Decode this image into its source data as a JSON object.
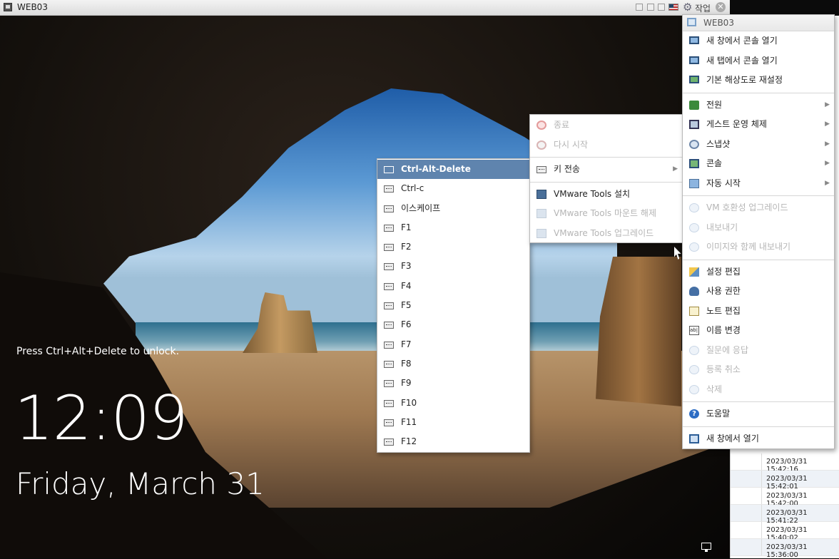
{
  "window": {
    "title": "WEB03",
    "action_label": "작업"
  },
  "lockscreen": {
    "unlock_hint": "Press Ctrl+Alt+Delete to unlock.",
    "time": "12:09",
    "date": "Friday, March 31"
  },
  "actions_menu": {
    "header": "WEB03",
    "items": [
      {
        "label": "새 창에서 콘솔 열기",
        "icon": "monitor-icon",
        "enabled": true
      },
      {
        "label": "새 탭에서 콘솔 열기",
        "icon": "monitor-icon",
        "enabled": true
      },
      {
        "label": "기본 해상도로 재설정",
        "icon": "monitor-reset-icon",
        "enabled": true
      },
      {
        "label": "전원",
        "icon": "power-icon",
        "enabled": true,
        "submenu": true
      },
      {
        "label": "게스트 운영 체제",
        "icon": "guest-os-icon",
        "enabled": true,
        "submenu": true
      },
      {
        "label": "스냅샷",
        "icon": "snapshot-icon",
        "enabled": true,
        "submenu": true
      },
      {
        "label": "콘솔",
        "icon": "console-icon",
        "enabled": true,
        "submenu": true
      },
      {
        "label": "자동 시작",
        "icon": "autostart-icon",
        "enabled": true,
        "submenu": true
      },
      {
        "label": "VM 호환성 업그레이드",
        "icon": "upgrade-icon",
        "enabled": false
      },
      {
        "label": "내보내기",
        "icon": "export-icon",
        "enabled": false
      },
      {
        "label": "이미지와 함께 내보내기",
        "icon": "export-image-icon",
        "enabled": false
      },
      {
        "label": "설정 편집",
        "icon": "edit-settings-icon",
        "enabled": true
      },
      {
        "label": "사용 권한",
        "icon": "permissions-icon",
        "enabled": true
      },
      {
        "label": "노트 편집",
        "icon": "edit-notes-icon",
        "enabled": true
      },
      {
        "label": "이름 변경",
        "icon": "rename-icon",
        "enabled": true
      },
      {
        "label": "질문에 응답",
        "icon": "answer-question-icon",
        "enabled": false
      },
      {
        "label": "등록 취소",
        "icon": "unregister-icon",
        "enabled": false
      },
      {
        "label": "삭제",
        "icon": "delete-icon",
        "enabled": false
      },
      {
        "label": "도움말",
        "icon": "help-icon",
        "enabled": true
      },
      {
        "label": "새 창에서 열기",
        "icon": "new-window-icon",
        "enabled": true
      }
    ]
  },
  "guest_os_menu": {
    "items": [
      {
        "label": "종료",
        "icon": "shutdown-icon",
        "enabled": false
      },
      {
        "label": "다시 시작",
        "icon": "restart-icon",
        "enabled": false
      },
      {
        "label": "키 전송",
        "icon": "keyboard-icon",
        "enabled": true,
        "submenu": true
      },
      {
        "label": "VMware Tools 설치",
        "icon": "vmware-tools-icon",
        "enabled": true
      },
      {
        "label": "VMware Tools 마운트 해제",
        "icon": "vmware-tools-icon",
        "enabled": false
      },
      {
        "label": "VMware Tools 업그레이드",
        "icon": "vmware-tools-upgrade-icon",
        "enabled": false
      }
    ]
  },
  "send_keys_menu": {
    "items": [
      "Ctrl-Alt-Delete",
      "Ctrl-c",
      "이스케이프",
      "F1",
      "F2",
      "F3",
      "F4",
      "F5",
      "F6",
      "F7",
      "F8",
      "F9",
      "F10",
      "F11",
      "F12"
    ],
    "highlighted": "Ctrl-Alt-Delete"
  },
  "event_list": {
    "timestamps": [
      "2023/03/31 15:42:16",
      "2023/03/31 15:42:01",
      "2023/03/31 15:42:00",
      "2023/03/31 15:41:22",
      "2023/03/31 15:40:02",
      "2023/03/31 15:36:00"
    ]
  }
}
